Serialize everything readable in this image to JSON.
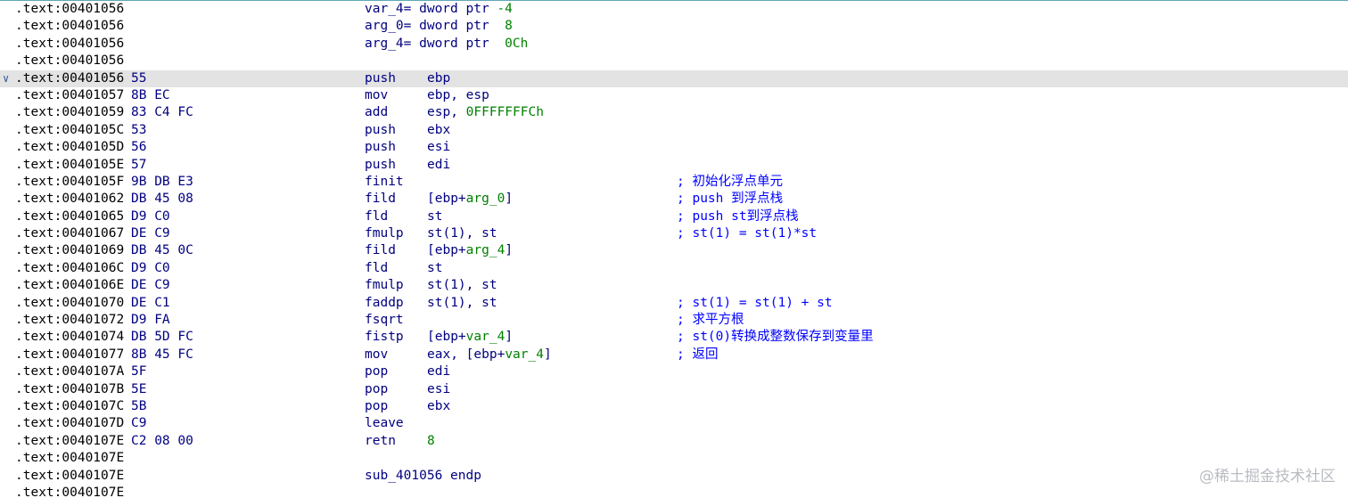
{
  "colors": {
    "address": "#000000",
    "code": "#000080",
    "number": "#008000",
    "comment": "#0000ff",
    "highlight_bg": "#e3e3e3"
  },
  "lines": [
    {
      "addr": ".text:00401056",
      "def": [
        {
          "t": "var_4",
          "c": "plain"
        },
        {
          "t": "= dword ptr ",
          "c": "plain"
        },
        {
          "t": "-4",
          "c": "num"
        }
      ]
    },
    {
      "addr": ".text:00401056",
      "def": [
        {
          "t": "arg_0",
          "c": "plain"
        },
        {
          "t": "= dword ptr  ",
          "c": "plain"
        },
        {
          "t": "8",
          "c": "num"
        }
      ]
    },
    {
      "addr": ".text:00401056",
      "def": [
        {
          "t": "arg_4",
          "c": "plain"
        },
        {
          "t": "= dword ptr  ",
          "c": "plain"
        },
        {
          "t": "0Ch",
          "c": "num"
        }
      ]
    },
    {
      "addr": ".text:00401056"
    },
    {
      "addr": ".text:00401056",
      "bytes": "55",
      "mnem": "push",
      "ops": [
        {
          "t": "ebp",
          "c": "plain"
        }
      ],
      "current": true,
      "icon": "chevron-down-icon"
    },
    {
      "addr": ".text:00401057",
      "bytes": "8B EC",
      "mnem": "mov",
      "ops": [
        {
          "t": "ebp, esp",
          "c": "plain"
        }
      ]
    },
    {
      "addr": ".text:00401059",
      "bytes": "83 C4 FC",
      "mnem": "add",
      "ops": [
        {
          "t": "esp, ",
          "c": "plain"
        },
        {
          "t": "0FFFFFFFCh",
          "c": "num"
        }
      ]
    },
    {
      "addr": ".text:0040105C",
      "bytes": "53",
      "mnem": "push",
      "ops": [
        {
          "t": "ebx",
          "c": "plain"
        }
      ]
    },
    {
      "addr": ".text:0040105D",
      "bytes": "56",
      "mnem": "push",
      "ops": [
        {
          "t": "esi",
          "c": "plain"
        }
      ]
    },
    {
      "addr": ".text:0040105E",
      "bytes": "57",
      "mnem": "push",
      "ops": [
        {
          "t": "edi",
          "c": "plain"
        }
      ]
    },
    {
      "addr": ".text:0040105F",
      "bytes": "9B DB E3",
      "mnem": "finit",
      "comment": "; 初始化浮点单元"
    },
    {
      "addr": ".text:00401062",
      "bytes": "DB 45 08",
      "mnem": "fild",
      "ops": [
        {
          "t": "[ebp+",
          "c": "plain"
        },
        {
          "t": "arg_0",
          "c": "var"
        },
        {
          "t": "]",
          "c": "plain"
        }
      ],
      "comment": "; push 到浮点栈"
    },
    {
      "addr": ".text:00401065",
      "bytes": "D9 C0",
      "mnem": "fld",
      "ops": [
        {
          "t": "st",
          "c": "plain"
        }
      ],
      "comment": "; push st到浮点栈"
    },
    {
      "addr": ".text:00401067",
      "bytes": "DE C9",
      "mnem": "fmulp",
      "ops": [
        {
          "t": "st(1), st",
          "c": "plain"
        }
      ],
      "comment": "; st(1) = st(1)*st"
    },
    {
      "addr": ".text:00401069",
      "bytes": "DB 45 0C",
      "mnem": "fild",
      "ops": [
        {
          "t": "[ebp+",
          "c": "plain"
        },
        {
          "t": "arg_4",
          "c": "var"
        },
        {
          "t": "]",
          "c": "plain"
        }
      ]
    },
    {
      "addr": ".text:0040106C",
      "bytes": "D9 C0",
      "mnem": "fld",
      "ops": [
        {
          "t": "st",
          "c": "plain"
        }
      ]
    },
    {
      "addr": ".text:0040106E",
      "bytes": "DE C9",
      "mnem": "fmulp",
      "ops": [
        {
          "t": "st(1), st",
          "c": "plain"
        }
      ]
    },
    {
      "addr": ".text:00401070",
      "bytes": "DE C1",
      "mnem": "faddp",
      "ops": [
        {
          "t": "st(1), st",
          "c": "plain"
        }
      ],
      "comment": "; st(1) = st(1) + st"
    },
    {
      "addr": ".text:00401072",
      "bytes": "D9 FA",
      "mnem": "fsqrt",
      "comment": "; 求平方根"
    },
    {
      "addr": ".text:00401074",
      "bytes": "DB 5D FC",
      "mnem": "fistp",
      "ops": [
        {
          "t": "[ebp+",
          "c": "plain"
        },
        {
          "t": "var_4",
          "c": "var"
        },
        {
          "t": "]",
          "c": "plain"
        }
      ],
      "comment": "; st(0)转换成整数保存到变量里"
    },
    {
      "addr": ".text:00401077",
      "bytes": "8B 45 FC",
      "mnem": "mov",
      "ops": [
        {
          "t": "eax, [ebp+",
          "c": "plain"
        },
        {
          "t": "var_4",
          "c": "var"
        },
        {
          "t": "]",
          "c": "plain"
        }
      ],
      "comment": "; 返回"
    },
    {
      "addr": ".text:0040107A",
      "bytes": "5F",
      "mnem": "pop",
      "ops": [
        {
          "t": "edi",
          "c": "plain"
        }
      ]
    },
    {
      "addr": ".text:0040107B",
      "bytes": "5E",
      "mnem": "pop",
      "ops": [
        {
          "t": "esi",
          "c": "plain"
        }
      ]
    },
    {
      "addr": ".text:0040107C",
      "bytes": "5B",
      "mnem": "pop",
      "ops": [
        {
          "t": "ebx",
          "c": "plain"
        }
      ]
    },
    {
      "addr": ".text:0040107D",
      "bytes": "C9",
      "mnem": "leave"
    },
    {
      "addr": ".text:0040107E",
      "bytes": "C2 08 00",
      "mnem": "retn",
      "ops": [
        {
          "t": "8",
          "c": "num"
        }
      ]
    },
    {
      "addr": ".text:0040107E"
    },
    {
      "addr": ".text:0040107E",
      "def": [
        {
          "t": "sub_401056 endp",
          "c": "plain"
        }
      ]
    },
    {
      "addr": ".text:0040107E"
    }
  ],
  "watermark": "@稀土掘金技术社区"
}
